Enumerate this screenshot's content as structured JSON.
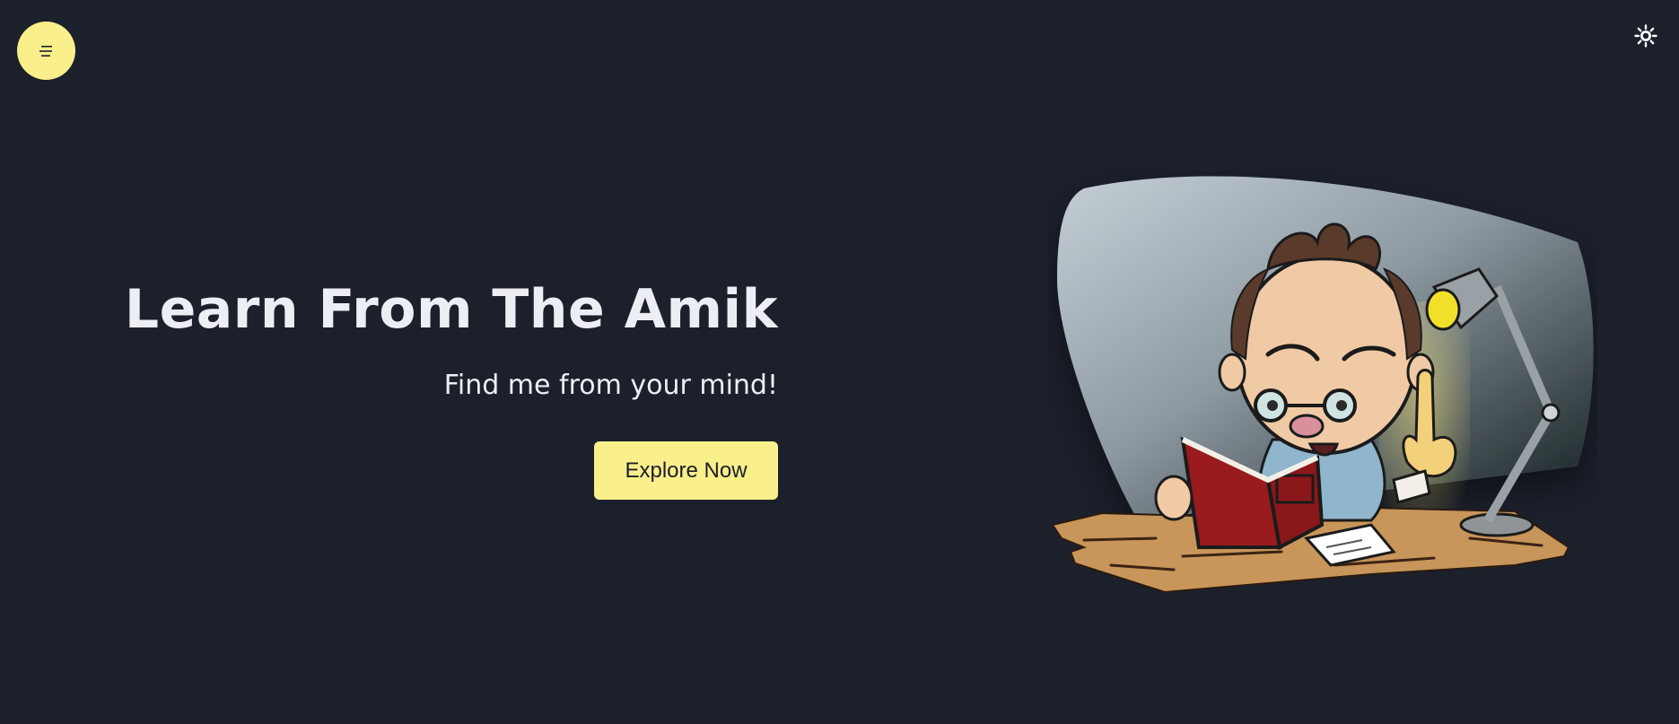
{
  "header": {
    "menu_icon": "menu-icon",
    "theme_icon": "sun-icon"
  },
  "hero": {
    "title": "Learn From The Amik",
    "subtitle": "Find me from your mind!",
    "cta_label": "Explore Now"
  },
  "colors": {
    "background": "#1c202b",
    "accent": "#f9ef8b",
    "text": "#eceef3"
  }
}
